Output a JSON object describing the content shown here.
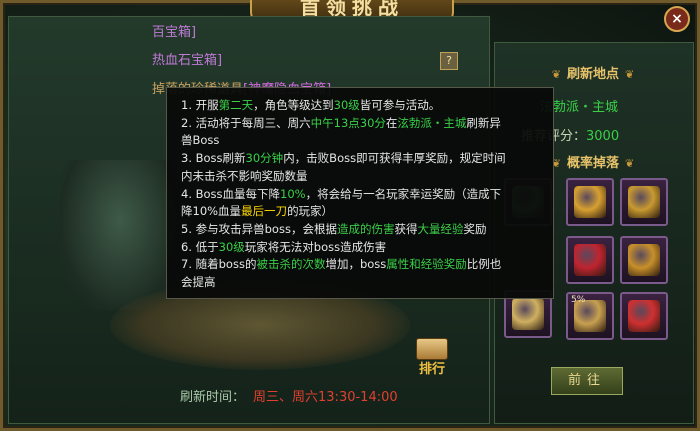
{
  "window": {
    "title": "首领挑战",
    "close_label": "×"
  },
  "drops_list": {
    "row1": "百宝箱]",
    "row2": "热血石宝箱]",
    "row3_prefix": "掉落的珍稀道具",
    "row3_item": "[神魔隐血宝箱]",
    "help_label": "?"
  },
  "rank_label": "排行",
  "refresh_time": {
    "label": "刷新时间：",
    "value": "周三、周六13:30-14:00"
  },
  "right_panel": {
    "refresh_location_title": "刷新地点",
    "location": "泫勃派・主城",
    "rating_label": "推荐评分：",
    "rating_value": "3000",
    "drops_title": "概率掉落",
    "go_button": "前往",
    "items": [
      {
        "icon": "ornate-chest-icon",
        "color": "#d8a030"
      },
      {
        "icon": "blue-chest-icon",
        "color": "#c99a30"
      },
      {
        "icon": "green-chest-icon",
        "color": "#5aa860"
      },
      {
        "icon": "red-gem-icon",
        "color": "#c02430"
      },
      {
        "icon": "gold-coin-icon",
        "color": "#c8902a"
      },
      {
        "icon": "tome-icon",
        "color": "#d0b060"
      },
      {
        "icon": "scroll-icon",
        "color": "#c8a050",
        "pct": "5%"
      },
      {
        "icon": "red-gift-box-icon",
        "color": "#d03030"
      }
    ]
  },
  "tooltip": {
    "l1a": "1. 开服",
    "l1b": "第二天",
    "l1c": "，角色等级达到",
    "l1d": "30级",
    "l1e": "皆可参与活动。",
    "l2a": "2. 活动将于每周三、周六",
    "l2b": "中午13点30分",
    "l2c": "在",
    "l2d": "泫勃派・主城",
    "l2e": "刷新异",
    "l3": "兽Boss",
    "l4a": "3. Boss刷新",
    "l4b": "30分钟",
    "l4c": "内，击败Boss即可获得丰厚奖励，规定时间",
    "l5": "内未击杀不影响奖励数量",
    "l6a": "4. Boss血量每下降",
    "l6b": "10%",
    "l6c": "，将会给与一名玩家幸运奖励（造成下",
    "l7a": "降10%血量",
    "l7b": "最后一刀",
    "l7c": "的玩家）",
    "l8a": "5. 参与攻击异兽boss，会根据",
    "l8b": "造成的伤害",
    "l8c": "获得",
    "l8d": "大量经验",
    "l8e": "奖励",
    "l9a": "6. 低于",
    "l9b": "30级",
    "l9c": "玩家将无法对boss造成伤害",
    "l10a": "7. 随着boss的",
    "l10b": "被击杀的次数",
    "l10c": "增加，boss",
    "l10d": "属性和经验奖励",
    "l10e": "比例也",
    "l11": "会提高"
  }
}
